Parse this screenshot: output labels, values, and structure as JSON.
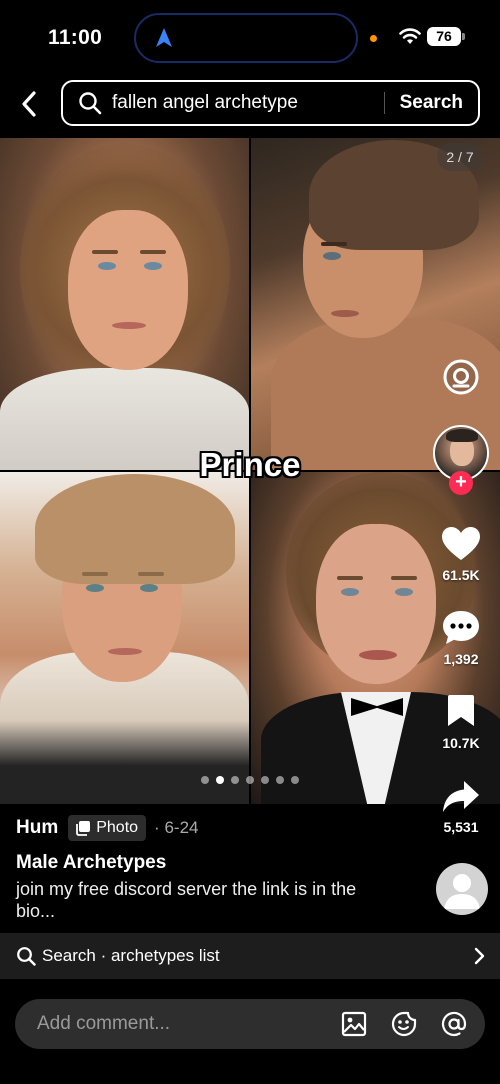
{
  "status_bar": {
    "time": "11:00",
    "battery": "76"
  },
  "search": {
    "query": "fallen angel archetype",
    "button_label": "Search"
  },
  "post": {
    "page_indicator": "2 / 7",
    "caption_overlay": "Prince",
    "total_slides": 7,
    "active_slide": 2,
    "author": "Hum",
    "type_badge": "Photo",
    "date_separator": "·",
    "date": "6-24",
    "title": "Male Archetypes",
    "description": "join my free discord server the link is in the bio..."
  },
  "actions": {
    "likes": "61.5K",
    "comments": "1,392",
    "saves": "10.7K",
    "shares": "5,531"
  },
  "related_search": {
    "text": "Search · archetypes list"
  },
  "comment": {
    "placeholder": "Add comment..."
  },
  "colors": {
    "follow_accent": "#fe2c55",
    "island_border": "#1a2a66",
    "status_orange": "#ff9500"
  },
  "icons": [
    "back-arrow-icon",
    "search-icon",
    "scan-icon",
    "heart-icon",
    "comment-icon",
    "bookmark-icon",
    "share-icon",
    "image-icon",
    "emoji-icon",
    "mention-icon",
    "chevron-right-icon"
  ]
}
